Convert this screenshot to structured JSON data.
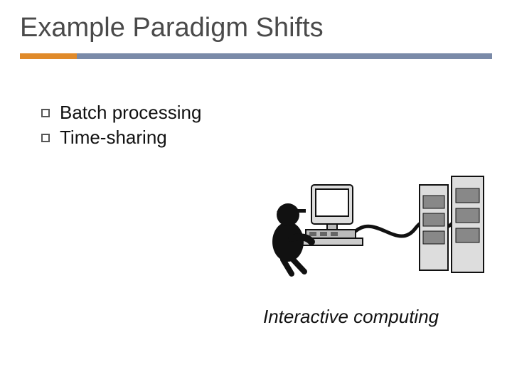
{
  "title": "Example Paradigm Shifts",
  "bullets": [
    "Batch processing",
    "Time-sharing"
  ],
  "caption": "Interactive computing",
  "colors": {
    "accent": "#e08a2a",
    "divider": "#7a8aa8",
    "title": "#4a4a4a"
  }
}
